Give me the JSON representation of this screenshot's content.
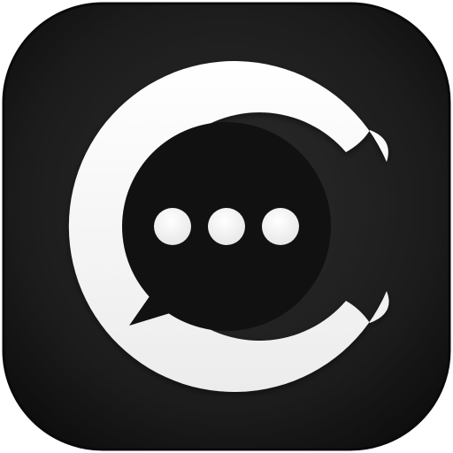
{
  "app_icon": {
    "name": "chat-app-icon",
    "logo_shape": "letter-c-with-speech-bubble",
    "bubble_dots": 3,
    "colors": {
      "tile_outer": "#0e0e0e",
      "tile_inner": "#2a2a2a",
      "logo": "#f7f7f7",
      "bubble": "#111111",
      "dots": "#f7f7f7"
    }
  }
}
